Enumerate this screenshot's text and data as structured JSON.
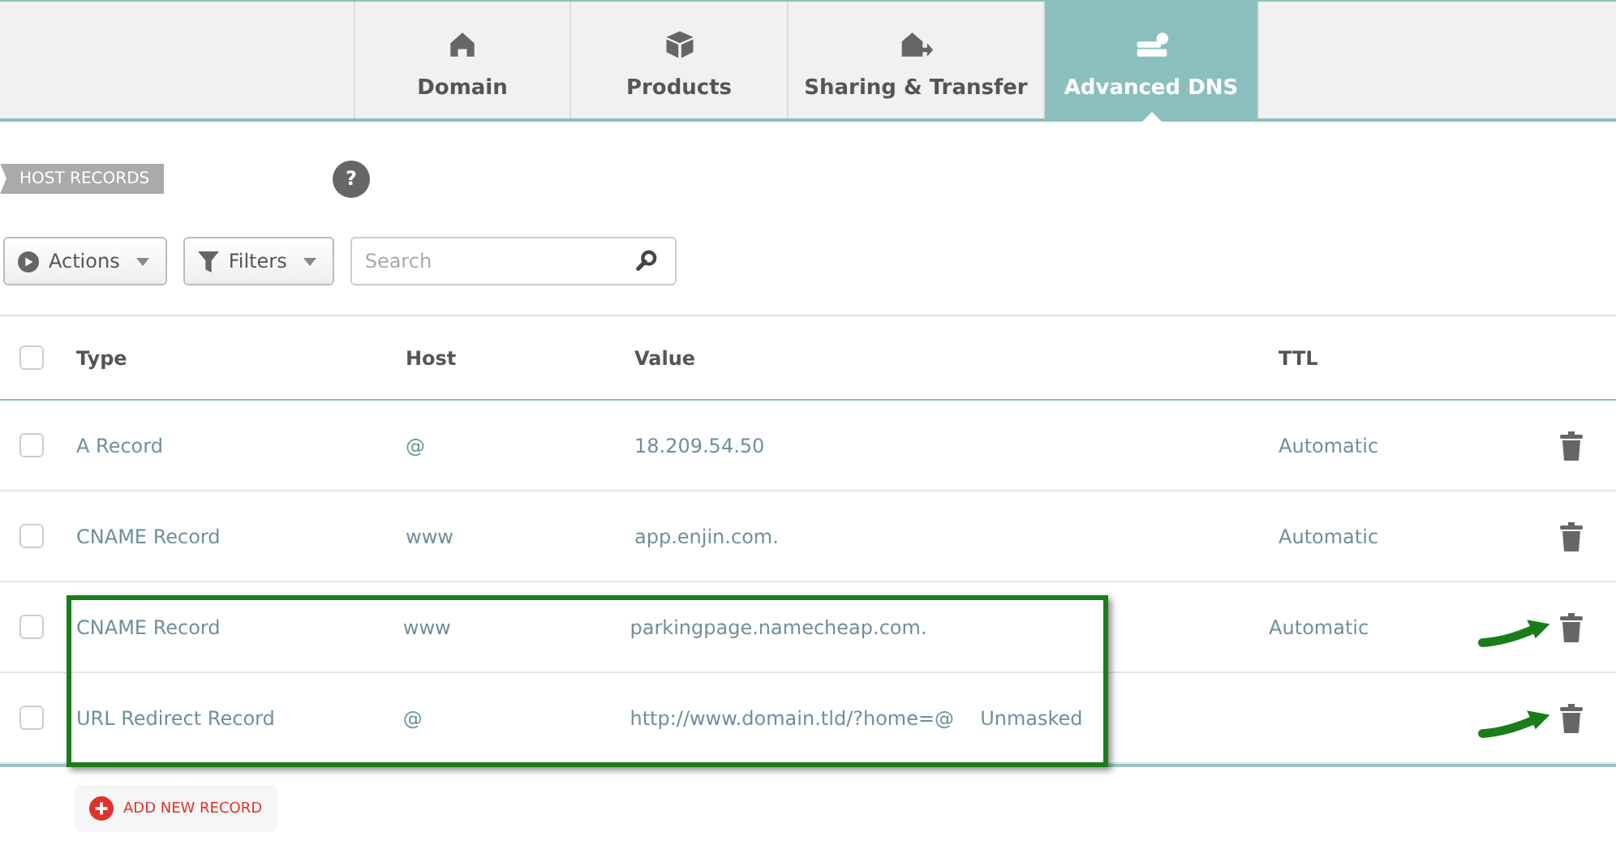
{
  "tabs": [
    {
      "label": "Domain",
      "selected": false
    },
    {
      "label": "Products",
      "selected": false
    },
    {
      "label": "Sharing & Transfer",
      "selected": false
    },
    {
      "label": "Advanced DNS",
      "selected": true
    }
  ],
  "section_label": "HOST RECORDS",
  "help": "?",
  "toolbar": {
    "actions": "Actions",
    "filters": "Filters",
    "search": {
      "placeholder": "Search"
    }
  },
  "table": {
    "columns": [
      "Type",
      "Host",
      "Value",
      "TTL"
    ],
    "header_checked": false,
    "rows": [
      {
        "type": "A Record",
        "host": "@",
        "value": "18.209.54.50",
        "mode": null,
        "ttl": "Automatic",
        "checked": false,
        "highlighted": false
      },
      {
        "type": "CNAME Record",
        "host": "www",
        "value": "app.enjin.com.",
        "mode": null,
        "ttl": "Automatic",
        "checked": false,
        "highlighted": false
      },
      {
        "type": "CNAME Record",
        "host": "www",
        "value": "parkingpage.namecheap.com.",
        "mode": null,
        "ttl": "Automatic",
        "checked": false,
        "highlighted": true
      },
      {
        "type": "URL Redirect Record",
        "host": "@",
        "value": "http://www.domain.tld/?home=@",
        "mode": "Unmasked",
        "ttl": null,
        "checked": false,
        "highlighted": true
      }
    ]
  },
  "add_button": "ADD NEW RECORD"
}
